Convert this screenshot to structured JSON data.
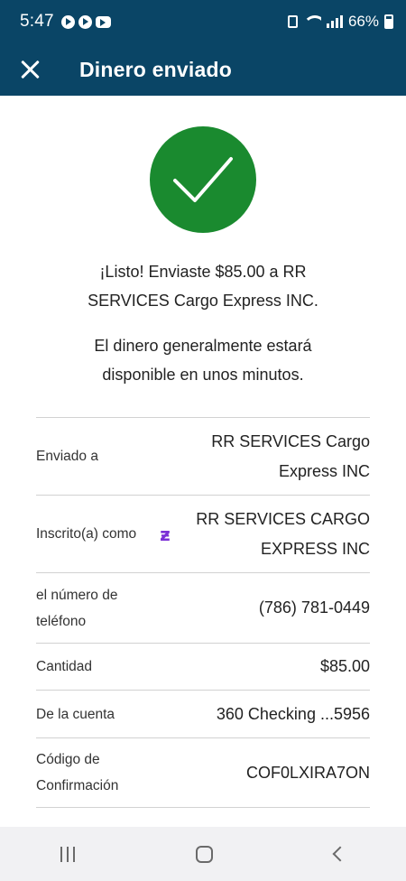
{
  "status_bar": {
    "time": "5:47",
    "battery": "66%",
    "app_icons": [
      "telegram-icon",
      "telegram-icon",
      "youtube-icon"
    ]
  },
  "header": {
    "title": "Dinero enviado",
    "close_icon": "close-icon",
    "background_color": "#0a4566"
  },
  "success": {
    "icon": "check-icon",
    "color": "#1a8a2f",
    "message_line1": "¡Listo! Enviaste $85.00 a RR",
    "message_line2": "SERVICES Cargo Express INC.",
    "info_line1": "El dinero generalmente estará",
    "info_line2": "disponible en unos minutos."
  },
  "details": [
    {
      "label": "Enviado a",
      "value_lines": [
        "RR SERVICES Cargo",
        "Express INC"
      ]
    },
    {
      "label": "Inscrito(a) como",
      "icon": "zelle-icon",
      "icon_glyph": "ƶ",
      "value_lines": [
        "RR SERVICES CARGO",
        "EXPRESS INC"
      ]
    },
    {
      "label_lines": [
        "el número de",
        "teléfono"
      ],
      "value": "(786) 781-0449"
    },
    {
      "label": "Cantidad",
      "value": "$85.00"
    },
    {
      "label": "De la cuenta",
      "value": "360 Checking ...5956"
    },
    {
      "label_lines": [
        "Código de",
        "Confirmación"
      ],
      "value": "COF0LXIRA7ON"
    }
  ],
  "nav_bar": {
    "icons": [
      "recent-apps-icon",
      "home-icon",
      "back-icon"
    ]
  }
}
